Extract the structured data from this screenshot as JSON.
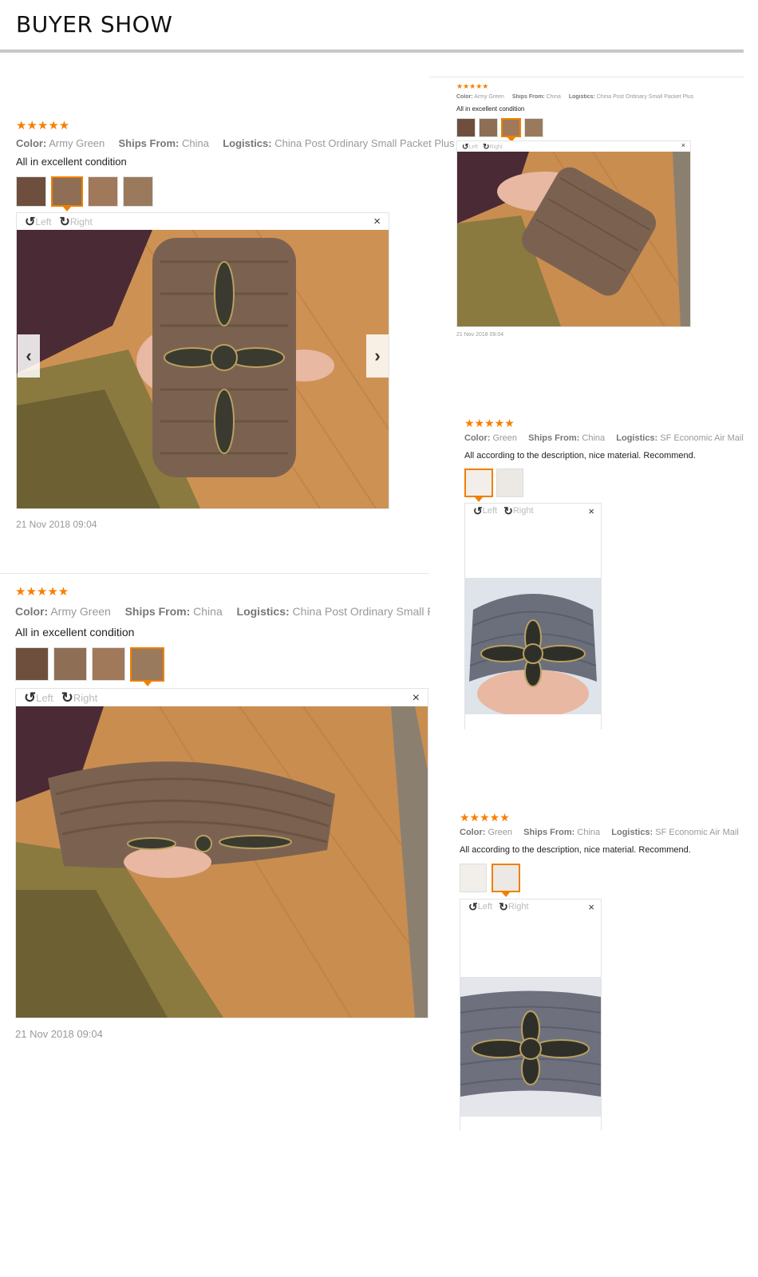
{
  "header": {
    "title": "BUYER SHOW"
  },
  "labels": {
    "color": "Color:",
    "ships_from": "Ships From:",
    "logistics": "Logistics:",
    "left": "Left",
    "right": "Right",
    "close": "×"
  },
  "icons": {
    "rotate_left": "rotate-left-icon",
    "rotate_right": "rotate-right-icon",
    "close": "close-icon",
    "star": "star-icon"
  },
  "colors": {
    "star": "#f77f00",
    "active_thumb": "#f08000",
    "rule": "#c8c8c8"
  },
  "reviews": [
    {
      "stars": "★★★★★",
      "color": "Army Green",
      "ships_from": "China",
      "logistics": "China Post Ordinary Small Packet Plus",
      "comment": "All in excellent condition",
      "date": "21 Nov 2018 09:04",
      "thumb_count": 4,
      "active_thumb": 2
    },
    {
      "stars": "★★★★★",
      "color": "Army Green",
      "ships_from": "China",
      "logistics": "China Post Ordinary Small Packet Plus",
      "comment": "All in excellent condition",
      "date": "21 Nov 2018 09:04",
      "thumb_count": 4,
      "active_thumb": 3
    },
    {
      "stars": "★★★★★",
      "color": "Green",
      "ships_from": "China",
      "logistics": "SF Economic Air Mail",
      "comment": "All according to the description, nice material. Recommend.",
      "thumb_count": 2,
      "active_thumb": 1
    },
    {
      "stars": "★★★★★",
      "color": "Army Green",
      "ships_from": "China",
      "logistics": "China Post Ordinary Small Pack",
      "comment": "All in excellent condition",
      "date": "21 Nov 2018 09:04",
      "thumb_count": 4,
      "active_thumb": 4
    },
    {
      "stars": "★★★★★",
      "color": "Green",
      "ships_from": "China",
      "logistics": "SF Economic Air Mail",
      "comment": "All according to the description, nice material. Recommend.",
      "thumb_count": 2,
      "active_thumb": 2
    }
  ]
}
